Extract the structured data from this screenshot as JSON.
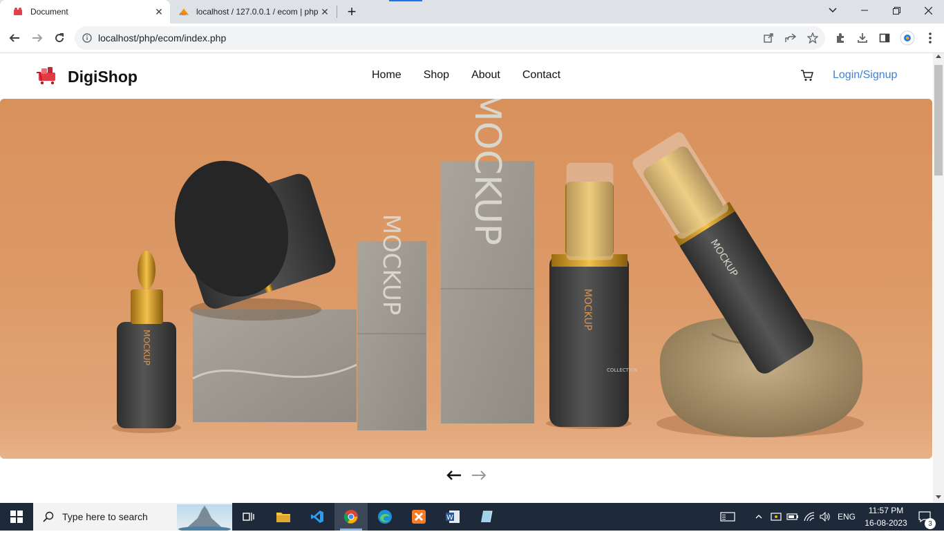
{
  "browser": {
    "tabs": [
      {
        "title": "Document",
        "active": true
      },
      {
        "title": "localhost / 127.0.0.1 / ecom | php",
        "active": false
      }
    ],
    "new_tab_icon": "plus-icon",
    "address": "localhost/php/ecom/index.php"
  },
  "site": {
    "brand": "DigiShop",
    "nav": [
      "Home",
      "Shop",
      "About",
      "Contact"
    ],
    "login": "Login/Signup"
  },
  "hero": {
    "product_mark": "MOCKUP",
    "label": "COLLECTION",
    "accent": "#d9915c"
  },
  "taskbar": {
    "search_placeholder": "Type here to search",
    "language": "ENG",
    "time": "11:57 PM",
    "date": "16-08-2023",
    "notification_count": "3"
  }
}
